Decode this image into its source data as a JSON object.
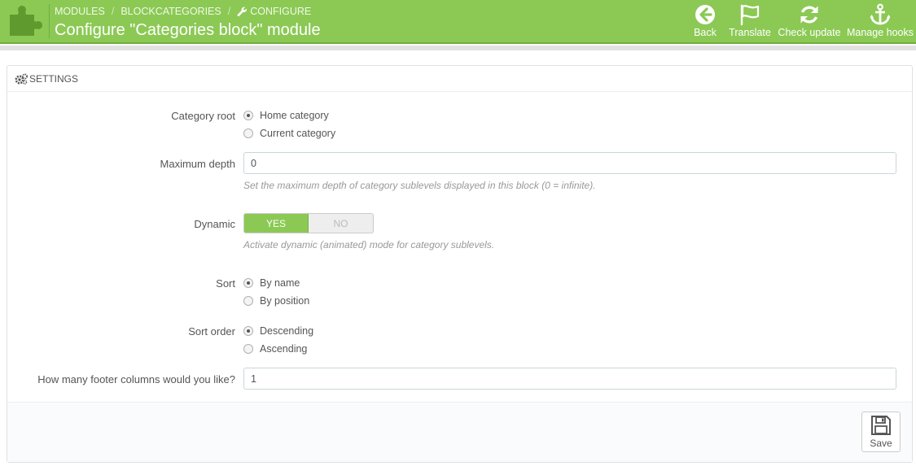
{
  "header": {
    "breadcrumb": [
      "MODULES",
      "BLOCKCATEGORIES",
      "CONFIGURE"
    ],
    "title": "Configure \"Categories block\" module",
    "toolbar": [
      {
        "label": "Back",
        "icon": "circle-arrow-left-icon"
      },
      {
        "label": "Translate",
        "icon": "flag-icon"
      },
      {
        "label": "Check update",
        "icon": "refresh-icon"
      },
      {
        "label": "Manage hooks",
        "icon": "anchor-icon"
      }
    ],
    "colors": {
      "accent": "#8bc954",
      "accent_dark": "#6fae3d"
    }
  },
  "panel": {
    "heading": "SETTINGS",
    "fields": {
      "category_root": {
        "label": "Category root",
        "options": [
          {
            "label": "Home category",
            "checked": true
          },
          {
            "label": "Current category",
            "checked": false
          }
        ]
      },
      "max_depth": {
        "label": "Maximum depth",
        "value": "0",
        "help": "Set the maximum depth of category sublevels displayed in this block (0 = infinite)."
      },
      "dynamic": {
        "label": "Dynamic",
        "yes": "YES",
        "no": "NO",
        "selected": "YES",
        "help": "Activate dynamic (animated) mode for category sublevels."
      },
      "sort": {
        "label": "Sort",
        "options": [
          {
            "label": "By name",
            "checked": true
          },
          {
            "label": "By position",
            "checked": false
          }
        ]
      },
      "sort_order": {
        "label": "Sort order",
        "options": [
          {
            "label": "Descending",
            "checked": true
          },
          {
            "label": "Ascending",
            "checked": false
          }
        ]
      },
      "footer_columns": {
        "label": "How many footer columns would you like?",
        "value": "1"
      }
    },
    "save_label": "Save"
  }
}
